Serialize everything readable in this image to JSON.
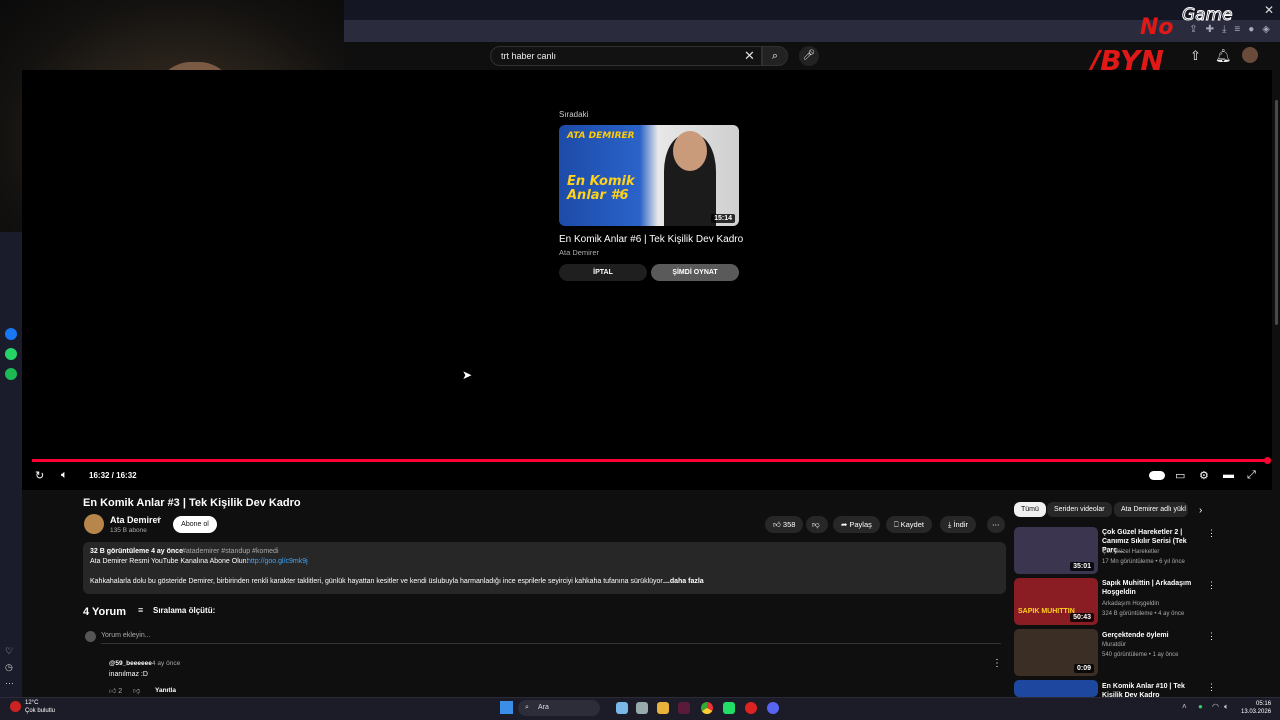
{
  "search": {
    "value": "trt haber canlı"
  },
  "up_next": {
    "label": "Sıradaki",
    "thumb_line1": "ATA DEMIRER",
    "thumb_line2": "En Komik Anlar #6",
    "duration": "15:14",
    "title": "En Komik Anlar #6 | Tek Kişilik Dev Kadro",
    "channel": "Ata Demirer",
    "cancel_label": "İPTAL",
    "play_now_label": "ŞİMDİ OYNAT"
  },
  "player": {
    "time": "16:32 / 16:32",
    "progress_fraction": 1.0
  },
  "video": {
    "title": "En Komik Anlar #3 | Tek Kişilik Dev Kadro",
    "channel": "Ata Demirer",
    "subscribers": "135 B abone",
    "subscribe_label": "Abone ol",
    "likes": "358",
    "share_label": "Paylaş",
    "save_label": "Kaydet",
    "download_label": "İndir"
  },
  "description": {
    "meta": "32 B görüntüleme  4 ay önce",
    "tags": "#atademirer #standup #komedi",
    "line1": "Ata Demirer Resmi YouTube Kanalına Abone Olun:",
    "link": "http://goo.gl/c9mk9j",
    "body": "Kahkahalarla dolu bu gösteride Demirer, birbirinden renkli karakter taklitleri, günlük hayattan kesitler ve kendi üslubuyla harmanladığı ince esprilerle seyirciyi kahkaha tufanına sürüklüyor.",
    "more": "...daha fazla"
  },
  "comments": {
    "count": "4 Yorum",
    "sort_label": "Sıralama ölçütü:",
    "input_placeholder": "Yorum ekleyin...",
    "items": [
      {
        "user": "@59_beeeeee",
        "time": "4 ay önce",
        "text": "inanılmaz :D",
        "likes": "2",
        "reply": "Yanıtla"
      }
    ]
  },
  "chips": [
    "Tümü",
    "Seriden videolar",
    "Ata Demirer adlı yükl"
  ],
  "recommendations": [
    {
      "title": "Çok Güzel Hareketler 2 | Canımız Sıkılır Serisi (Tek Parç...",
      "channel": "Çok Güzel Hareketler",
      "meta": "17 Mn görüntüleme • 6 yıl önce",
      "duration": "35:01",
      "color": "#3b3550"
    },
    {
      "title": "Sapık Muhittin | Arkadaşım Hoşgeldin",
      "channel": "Arkadaşım Hoşgeldin",
      "meta": "324 B görüntüleme • 4 ay önce",
      "duration": "50:43",
      "color": "#8a1c24",
      "thumb_text": "SAPIK MUHITTIN"
    },
    {
      "title": "Gerçektende öylemi",
      "channel": "Muratdür",
      "meta": "540 görüntüleme • 1 ay önce",
      "duration": "0:09",
      "color": "#3a2e25"
    },
    {
      "title": "En Komik Anlar #10 | Tek Kişilik Dev Kadro",
      "channel": "",
      "meta": "",
      "duration": "",
      "color": "#1e47a0"
    }
  ],
  "overlay_logo": "NoGame BYN",
  "taskbar": {
    "weather_temp": "12°C",
    "weather_text": "Çok bulutlu",
    "search_label": "Ara",
    "time": "05:16",
    "date": "13.03.2026"
  },
  "colors": {
    "accent": "#ff0033",
    "link": "#3ea6ff",
    "background": "#0f0f0f"
  }
}
